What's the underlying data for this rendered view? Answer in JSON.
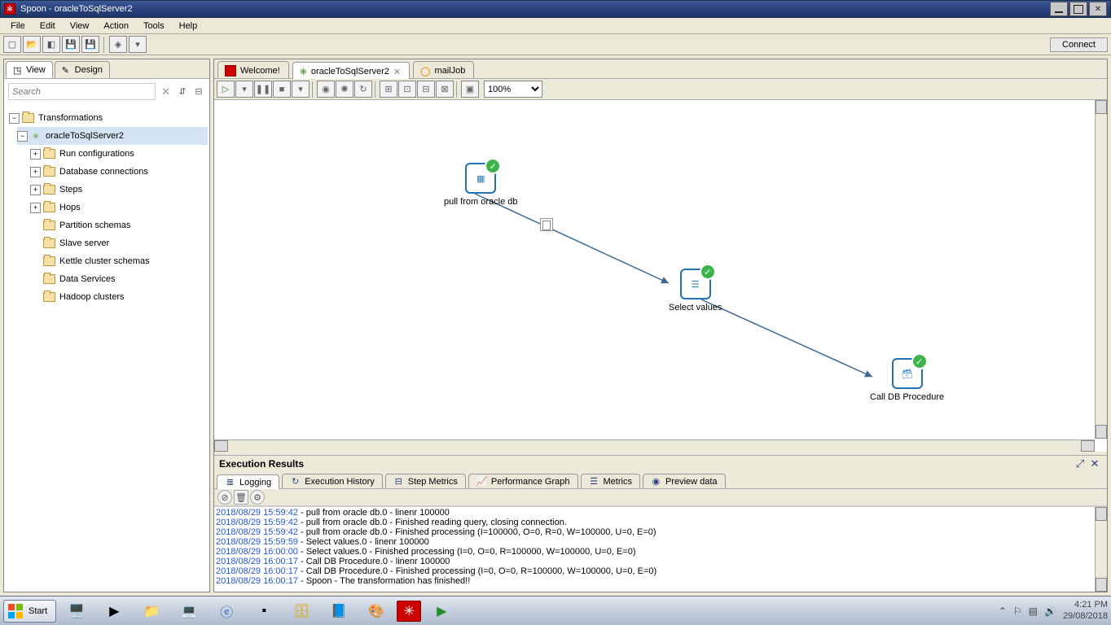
{
  "window": {
    "title": "Spoon - oracleToSqlServer2"
  },
  "menu": {
    "file": "File",
    "edit": "Edit",
    "view": "View",
    "action": "Action",
    "tools": "Tools",
    "help": "Help"
  },
  "toolbar": {
    "connect": "Connect"
  },
  "sidebar": {
    "tab_view": "View",
    "tab_design": "Design",
    "search_placeholder": "Search",
    "root": "Transformations",
    "trans_name": "oracleToSqlServer2",
    "nodes": {
      "run_config": "Run configurations",
      "db_conn": "Database connections",
      "steps": "Steps",
      "hops": "Hops",
      "partition": "Partition schemas",
      "slave": "Slave server",
      "cluster": "Kettle cluster schemas",
      "data_svc": "Data Services",
      "hadoop": "Hadoop clusters"
    }
  },
  "editor": {
    "tab_welcome": "Welcome!",
    "tab_trans": "oracleToSqlServer2",
    "tab_job": "mailJob",
    "zoom": "100%"
  },
  "steps": {
    "s1": "pull from oracle db",
    "s2": "Select values",
    "s3": "Call DB Procedure"
  },
  "results": {
    "title": "Execution Results",
    "tabs": {
      "logging": "Logging",
      "exec_hist": "Execution History",
      "step_metrics": "Step Metrics",
      "perf_graph": "Performance Graph",
      "metrics": "Metrics",
      "preview": "Preview data"
    },
    "log": [
      {
        "ts": "2018/08/29 15:59:42",
        "msg": " - pull from oracle db.0 - linenr 100000"
      },
      {
        "ts": "2018/08/29 15:59:42",
        "msg": " - pull from oracle db.0 - Finished reading query, closing connection."
      },
      {
        "ts": "2018/08/29 15:59:42",
        "msg": " - pull from oracle db.0 - Finished processing (I=100000, O=0, R=0, W=100000, U=0, E=0)"
      },
      {
        "ts": "2018/08/29 15:59:59",
        "msg": " - Select values.0 - linenr 100000"
      },
      {
        "ts": "2018/08/29 16:00:00",
        "msg": " - Select values.0 - Finished processing (I=0, O=0, R=100000, W=100000, U=0, E=0)"
      },
      {
        "ts": "2018/08/29 16:00:17",
        "msg": " - Call DB Procedure.0 - linenr 100000"
      },
      {
        "ts": "2018/08/29 16:00:17",
        "msg": " - Call DB Procedure.0 - Finished processing (I=0, O=0, R=100000, W=100000, U=0, E=0)"
      },
      {
        "ts": "2018/08/29 16:00:17",
        "msg": " - Spoon - The transformation has finished!!"
      }
    ]
  },
  "taskbar": {
    "start": "Start",
    "time": "4:21 PM",
    "date": "29/08/2018"
  }
}
